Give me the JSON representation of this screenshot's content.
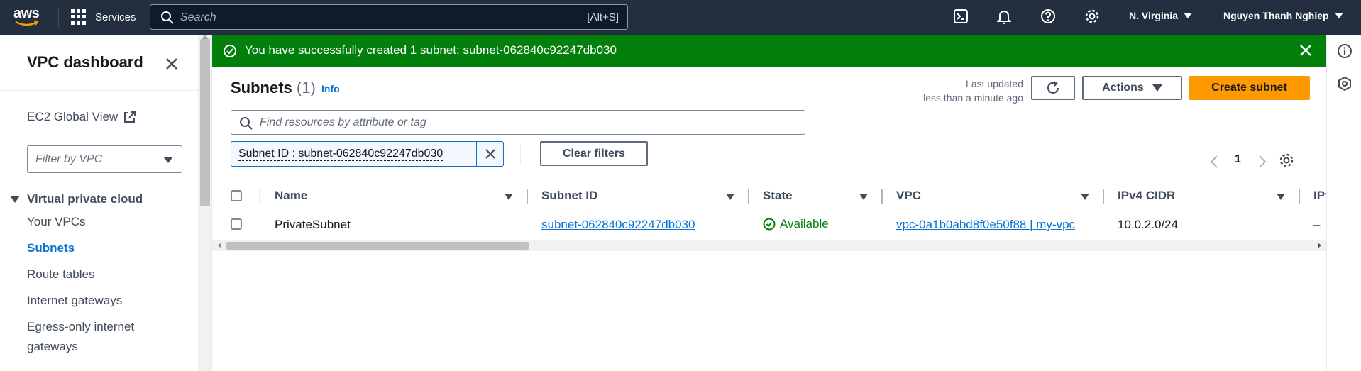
{
  "topnav": {
    "logo_text": "aws",
    "services_label": "Services",
    "search_placeholder": "Search",
    "search_shortcut": "[Alt+S]",
    "region": "N. Virginia",
    "user": "Nguyen Thanh Nghiep"
  },
  "sidebar": {
    "title": "VPC dashboard",
    "ec2_global_view": "EC2 Global View",
    "filter_placeholder": "Filter by VPC",
    "section_title": "Virtual private cloud",
    "items": [
      {
        "label": "Your VPCs",
        "active": false
      },
      {
        "label": "Subnets",
        "active": true
      },
      {
        "label": "Route tables",
        "active": false
      },
      {
        "label": "Internet gateways",
        "active": false
      },
      {
        "label": "Egress-only internet",
        "active": false
      },
      {
        "label": "gateways",
        "active": false
      }
    ]
  },
  "flash": {
    "message": "You have successfully created 1 subnet: subnet-062840c92247db030",
    "color": "#037f0c"
  },
  "page": {
    "title": "Subnets",
    "count": "(1)",
    "info": "Info",
    "last_updated_line1": "Last updated",
    "last_updated_line2": "less than a minute ago",
    "actions_label": "Actions",
    "create_label": "Create subnet",
    "find_placeholder": "Find resources by attribute or tag",
    "filter_token": "Subnet ID : subnet-062840c92247db030",
    "clear_filters": "Clear filters",
    "page_number": "1"
  },
  "table": {
    "columns": [
      "Name",
      "Subnet ID",
      "State",
      "VPC",
      "IPv4 CIDR",
      "IPv"
    ],
    "rows": [
      {
        "name": "PrivateSubnet",
        "subnet_id": "subnet-062840c92247db030",
        "state": "Available",
        "vpc": "vpc-0a1b0abd8f0e50f88 | my-vpc",
        "ipv4_cidr": "10.0.2.0/24",
        "ipv6": "–"
      }
    ]
  },
  "colors": {
    "accent": "#0972d3",
    "primary_button": "#ff9900",
    "nav_bg": "#232f3e",
    "success": "#037f0c"
  }
}
